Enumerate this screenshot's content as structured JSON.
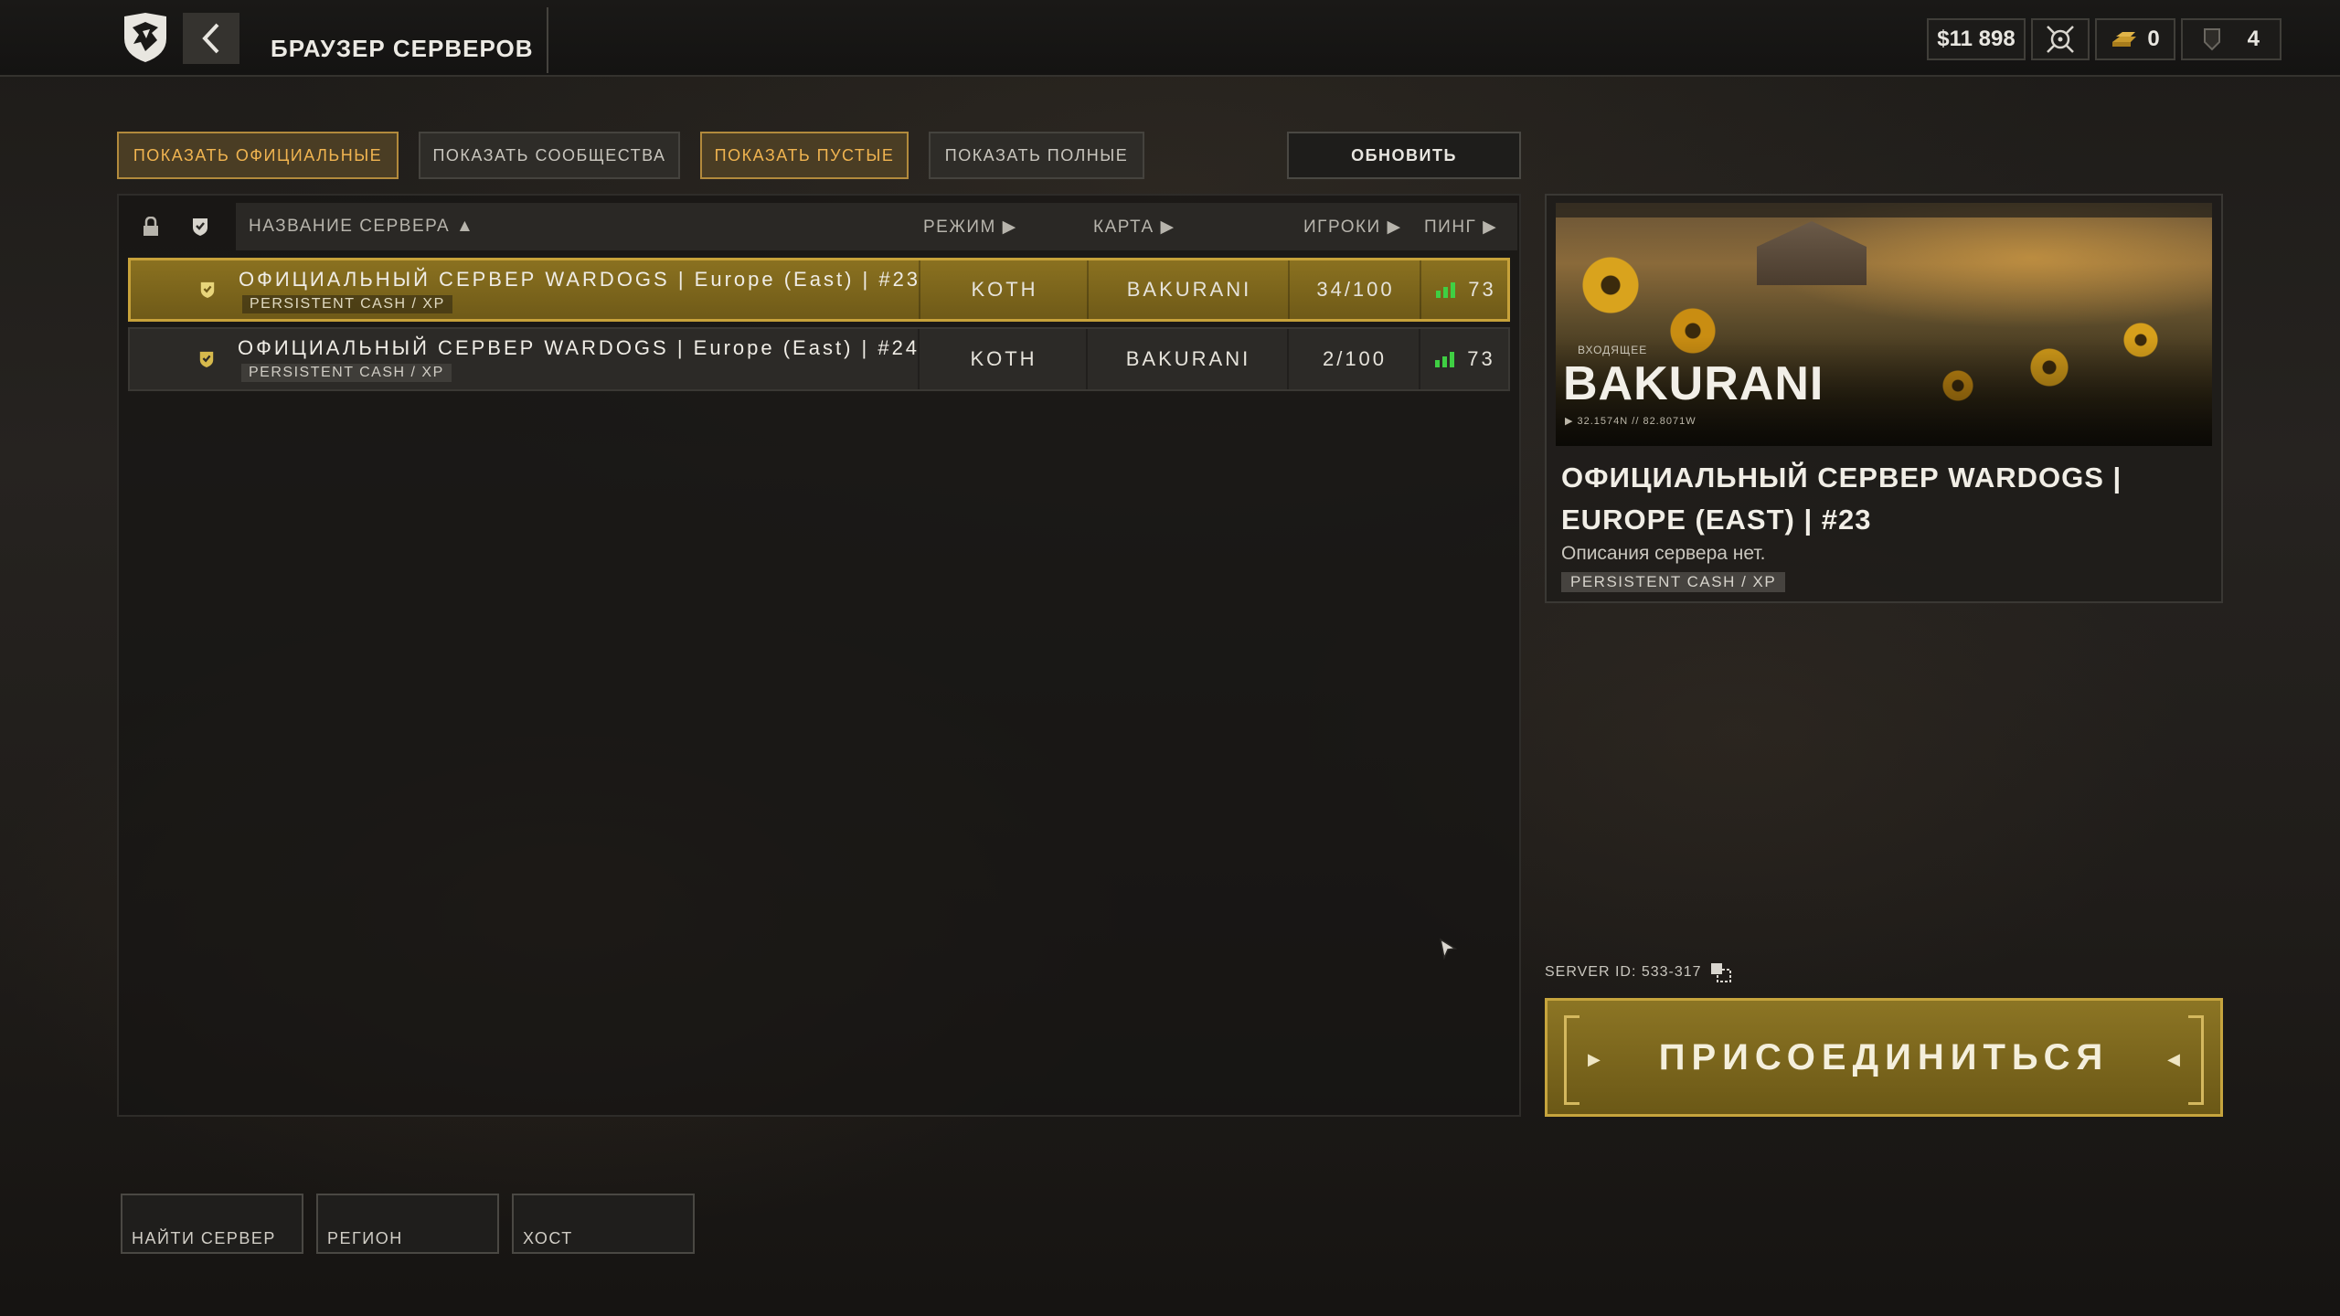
{
  "header": {
    "title": "БРАУЗЕР СЕРВЕРОВ",
    "money": "$11 898",
    "gold_count": "0",
    "tokens_count": "4"
  },
  "filters": {
    "official": "ПОКАЗАТЬ ОФИЦИАЛЬНЫЕ",
    "community": "ПОКАЗАТЬ СООБЩЕСТВА",
    "empty": "ПОКАЗАТЬ ПУСТЫЕ",
    "full": "ПОКАЗАТЬ ПОЛНЫЕ",
    "refresh": "ОБНОВИТЬ"
  },
  "table": {
    "columns": {
      "name": "НАЗВАНИЕ СЕРВЕРА ▲",
      "mode": "РЕЖИМ ▶",
      "map": "КАРТА ▶",
      "players": "ИГРОКИ ▶",
      "ping": "ПИНГ ▶"
    },
    "rows": [
      {
        "name": "ОФИЦИАЛЬНЫЙ СЕРВЕР WARDOGS | Europe (East) | #23",
        "tag": "PERSISTENT CASH / XP",
        "mode": "KOTH",
        "map": "BAKURANI",
        "players": "34/100",
        "ping": "73",
        "selected": true
      },
      {
        "name": "ОФИЦИАЛЬНЫЙ СЕРВЕР WARDOGS | Europe (East) | #24",
        "tag": "PERSISTENT CASH / XP",
        "mode": "KOTH",
        "map": "BAKURANI",
        "players": "2/100",
        "ping": "73",
        "selected": false
      }
    ]
  },
  "details": {
    "incoming": "ВХОДЯЩЕЕ",
    "map_name": "BAKURANI",
    "coords": "32.1574N // 82.8071W",
    "title": "ОФИЦИАЛЬНЫЙ СЕРВЕР WARDOGS | EUROPE (EAST) | #23",
    "description": "Описания сервера нет.",
    "tag": "PERSISTENT CASH / XP"
  },
  "server_id": "SERVER ID: 533-317",
  "join_label": "ПРИСОЕДИНИТЬСЯ",
  "bottom": {
    "find": "НАЙТИ СЕРВЕР",
    "region": "РЕГИОН",
    "host": "ХОСТ"
  },
  "colors": {
    "accent_gold": "#c7a23a",
    "active_filter_text": "#f0b450",
    "ping_green": "#3fcf43"
  }
}
